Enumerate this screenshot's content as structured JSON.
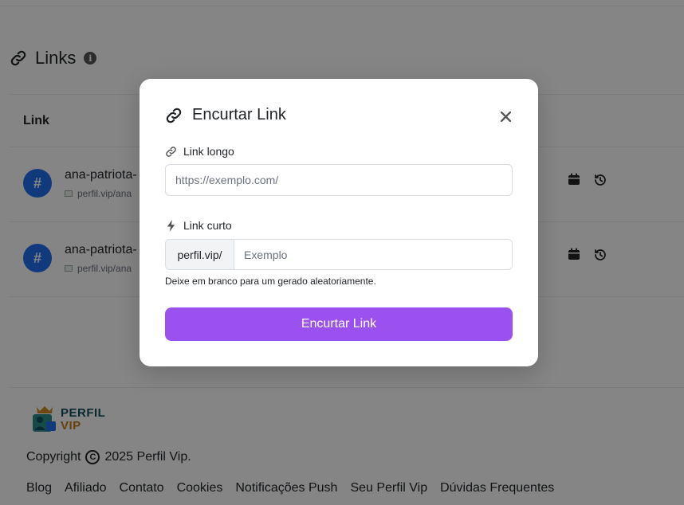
{
  "page": {
    "title": "Links",
    "table": {
      "column_link": "Link",
      "rows": [
        {
          "avatar": "#",
          "name": "ana-patriota-",
          "url": "perfil.vip/ana"
        },
        {
          "avatar": "#",
          "name": "ana-patriota-",
          "url": "perfil.vip/ana"
        }
      ]
    }
  },
  "footer": {
    "logo_line1": "PERFIL",
    "logo_line2": "VIP",
    "copyright_label": "Copyright",
    "copyright_symbol": "C",
    "copyright_text": "2025 Perfil Vip.",
    "links": [
      "Blog",
      "Afiliado",
      "Contato",
      "Cookies",
      "Notificações Push",
      "Seu Perfil Vip",
      "Dúvidas Frequentes"
    ]
  },
  "modal": {
    "title": "Encurtar Link",
    "long_link_label": "Link longo",
    "long_link_placeholder": "https://exemplo.com/",
    "long_link_value": "",
    "short_link_label": "Link curto",
    "short_link_prefix": "perfil.vip/",
    "short_link_placeholder": "Exemplo",
    "short_link_value": "",
    "help_text": "Deixe em branco para um gerado aleatoriamente.",
    "submit_label": "Encurtar Link"
  },
  "colors": {
    "accent": "#9b51ef",
    "avatar": "#1f6feb",
    "overlay": "rgba(0,0,0,0.48)"
  }
}
